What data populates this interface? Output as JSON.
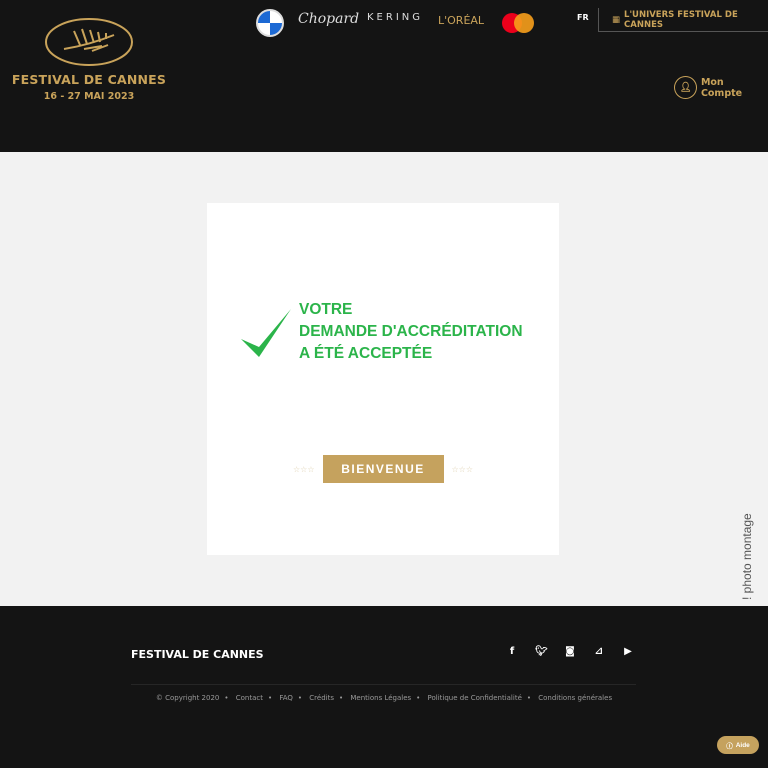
{
  "header": {
    "brand": "FESTIVAL DE CANNES",
    "dates": "16 - 27 MAI 2023",
    "sponsors": [
      "BMW",
      "Chopard",
      "KERING",
      "L'ORÉAL",
      "Mastercard"
    ],
    "language": "FR",
    "universe_link": "L'UNIVERS FESTIVAL DE CANNES",
    "account": "Mon Compte"
  },
  "main": {
    "message": [
      "VOTRE",
      "DEMANDE D'ACCRÉDITATION",
      "A ÉTÉ ACCEPTÉE"
    ],
    "stars": "☆☆☆",
    "button": "BIENVENUE",
    "photo_credit": "! photo montage"
  },
  "footer": {
    "brand": "FESTIVAL DE CANNES",
    "social": [
      "facebook-icon",
      "twitter-icon",
      "instagram-icon",
      "rss-icon",
      "youtube-icon"
    ],
    "links": [
      "© Copyright 2020",
      "Contact",
      "FAQ",
      "Crédits",
      "Mentions Légales",
      "Politique de Confidentialité",
      "Conditions générales"
    ],
    "help": "Aide"
  },
  "colors": {
    "gold": "#c9a35a",
    "success": "#2bb44a",
    "dark": "#141414"
  }
}
